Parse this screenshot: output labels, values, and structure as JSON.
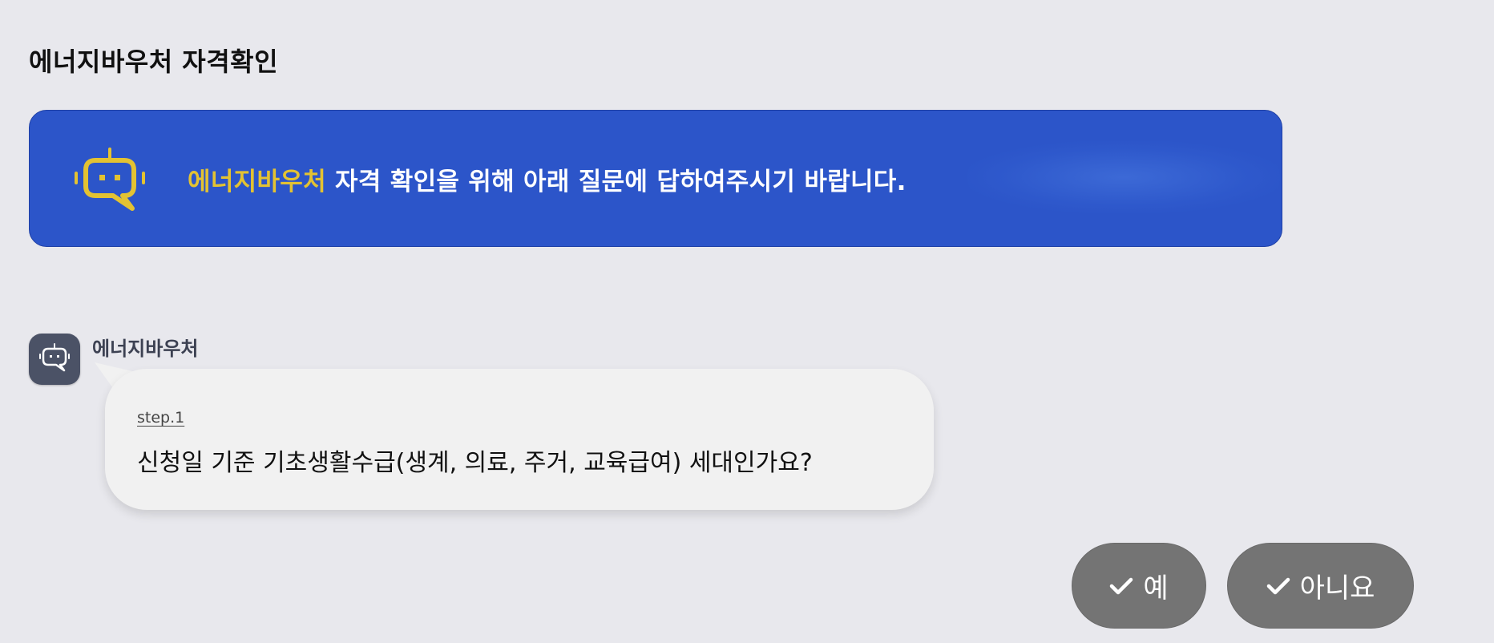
{
  "page": {
    "title": "에너지바우처 자격확인"
  },
  "banner": {
    "highlight": "에너지바우처",
    "message": " 자격 확인을 위해 아래 질문에 답하여주시기 바랍니다.",
    "icon": "robot-chat-icon",
    "colors": {
      "background": "#2c55c9",
      "highlight": "#e3c232",
      "icon": "#e3c232"
    }
  },
  "chat": {
    "bot_name": "에너지바우처",
    "bot_icon": "robot-chat-icon",
    "step": "step.1",
    "question": "신청일 기준 기초생활수급(생계, 의료, 주거, 교육급여) 세대인가요?"
  },
  "answers": {
    "yes_label": "예",
    "no_label": "아니요",
    "icon": "check-icon",
    "button_color": "#747474"
  }
}
